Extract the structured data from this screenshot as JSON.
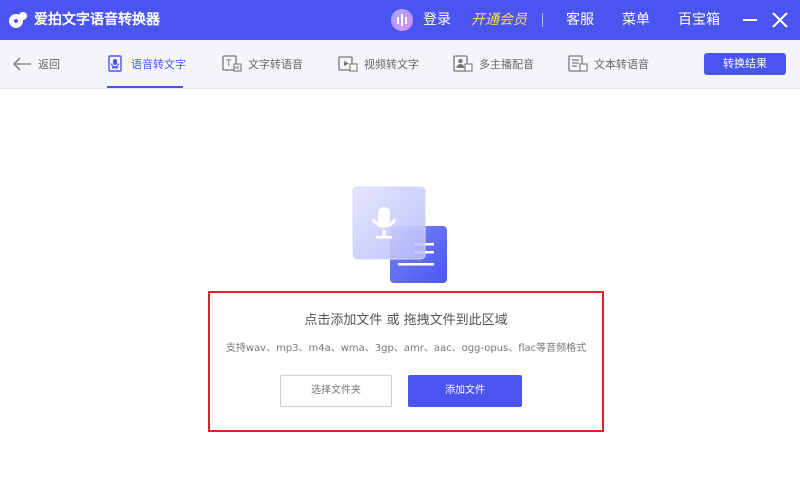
{
  "app": {
    "title": "爱拍文字语音转换器",
    "accent_color": "#4a55f0"
  },
  "titlebar": {
    "login": "登录",
    "vip": "开通会员",
    "service": "客服",
    "menu": "菜单",
    "toolbox": "百宝箱",
    "icons": [
      "app-logo-icon",
      "avatar-icon",
      "minimize-icon",
      "close-icon"
    ]
  },
  "nav": {
    "back": "返回",
    "tabs": [
      {
        "label": "语音转文字",
        "active": true,
        "icon": "voice-doc-icon"
      },
      {
        "label": "文字转语音",
        "active": false,
        "icon": "text-to-voice-icon"
      },
      {
        "label": "视频转文字",
        "active": false,
        "icon": "video-icon"
      },
      {
        "label": "多主播配音",
        "active": false,
        "icon": "dubbing-icon"
      },
      {
        "label": "文本转语音",
        "active": false,
        "icon": "document-icon"
      }
    ],
    "result_button": "转换结果"
  },
  "dropzone": {
    "title": "点击添加文件 或 拖拽文件到此区域",
    "formats": "支持wav、mp3、m4a、wma、3gp、amr、aac、ogg-opus、flac等音频格式",
    "select_folder": "选择文件夹",
    "add_file": "添加文件",
    "illustration_icon": "microphone-document-icon"
  }
}
